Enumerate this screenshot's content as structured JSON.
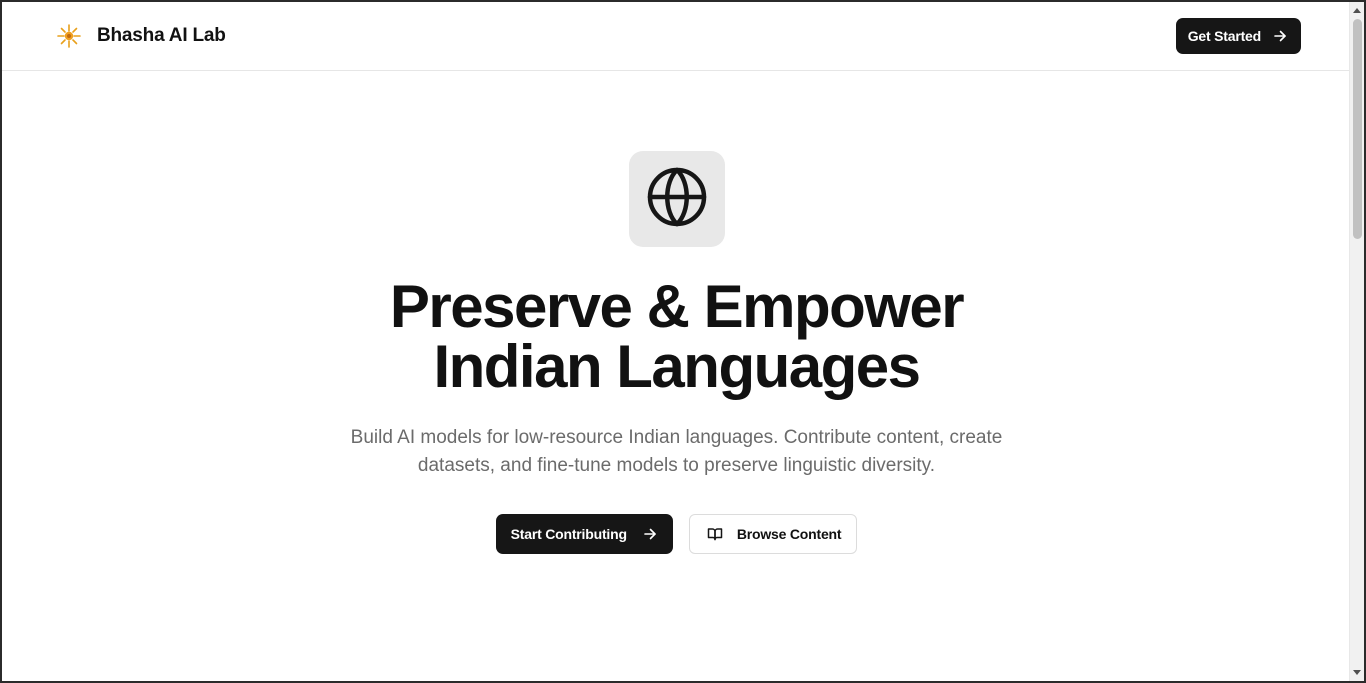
{
  "header": {
    "brand_name": "Bhasha AI Lab",
    "logo_icon": "sparkle-sun-icon",
    "cta_label": "Get Started"
  },
  "hero": {
    "icon": "globe-icon",
    "title_line1": "Preserve & Empower",
    "title_line2": "Indian Languages",
    "subtitle": "Build AI models for low-resource Indian languages. Contribute content, create datasets, and fine-tune models to preserve linguistic diversity.",
    "primary_button": "Start Contributing",
    "secondary_button": "Browse Content",
    "secondary_icon": "book-open-icon"
  },
  "colors": {
    "accent": "#f0a020",
    "button_dark": "#161616",
    "muted_text": "#6b6b6b",
    "tile_bg": "#e8e8e8"
  }
}
